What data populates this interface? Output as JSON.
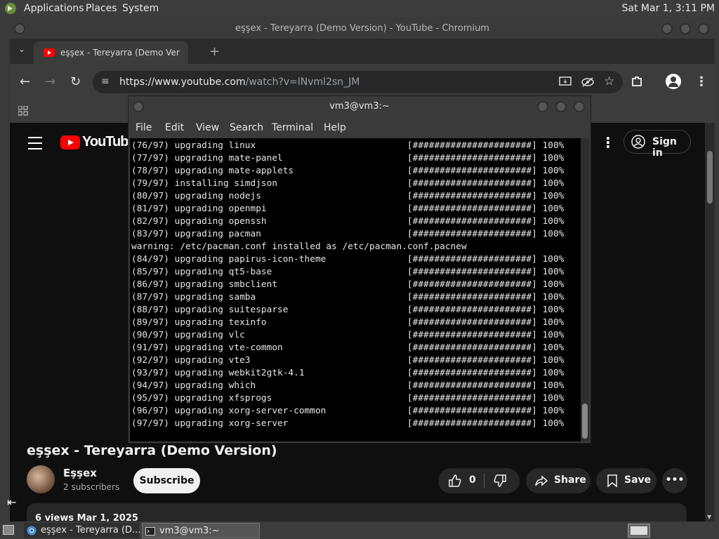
{
  "top_panel": {
    "menus": [
      "Applications",
      "Places",
      "System"
    ],
    "clock": "Sat Mar  1,  3:11 PM"
  },
  "browser": {
    "window_title": "eşşex - Tereyarra (Demo Version) - YouTube - Chromium",
    "tab_title": "eşşex - Tereyarra (Demo Ver",
    "new_tab": "+",
    "url_host": "https://www.youtube.com",
    "url_path": "/watch?v=lNvml2sn_JM"
  },
  "youtube": {
    "logo_text": "YouTube",
    "sign_in": "Sign in",
    "video_title": "eşşex - Tereyarra (Demo Version)",
    "channel_name": "Eşşex",
    "subscribers": "2 subscribers",
    "subscribe": "Subscribe",
    "likes": "0",
    "share": "Share",
    "save": "Save",
    "more": "•••",
    "description_meta": "6 views  Mar 1, 2025"
  },
  "terminal": {
    "title": "vm3@vm3:~",
    "menus": [
      "File",
      "Edit",
      "View",
      "Search",
      "Terminal",
      "Help"
    ],
    "lines": [
      "(76/97) upgrading linux                            [######################] 100%",
      "(77/97) upgrading mate-panel                       [######################] 100%",
      "(78/97) upgrading mate-applets                     [######################] 100%",
      "(79/97) installing simdjson                        [######################] 100%",
      "(80/97) upgrading nodejs                           [######################] 100%",
      "(81/97) upgrading openmpi                          [######################] 100%",
      "(82/97) upgrading openssh                          [######################] 100%",
      "(83/97) upgrading pacman                           [######################] 100%",
      "warning: /etc/pacman.conf installed as /etc/pacman.conf.pacnew",
      "(84/97) upgrading papirus-icon-theme               [######################] 100%",
      "(85/97) upgrading qt5-base                         [######################] 100%",
      "(86/97) upgrading smbclient                        [######################] 100%",
      "(87/97) upgrading samba                            [######################] 100%",
      "(88/97) upgrading suitesparse                      [######################] 100%",
      "(89/97) upgrading texinfo                          [######################] 100%",
      "(90/97) upgrading vlc                              [######################] 100%",
      "(91/97) upgrading vte-common                       [######################] 100%",
      "(92/97) upgrading vte3                             [######################] 100%",
      "(93/97) upgrading webkit2gtk-4.1                   [######################] 100%",
      "(94/97) upgrading which                            [######################] 100%",
      "(95/97) upgrading xfsprogs                         [######################] 100%",
      "(96/97) upgrading xorg-server-common               [######################] 100%",
      "(97/97) upgrading xorg-server                      [######################] 100%"
    ]
  },
  "taskbar": {
    "items": [
      "eşşex - Tereyarra (D...",
      "vm3@vm3:~"
    ]
  },
  "colors": {
    "panel": "#3c3c3c",
    "youtube_red": "#ff0000",
    "yt_background": "#0f0f0f",
    "terminal_bg": "#000000"
  }
}
